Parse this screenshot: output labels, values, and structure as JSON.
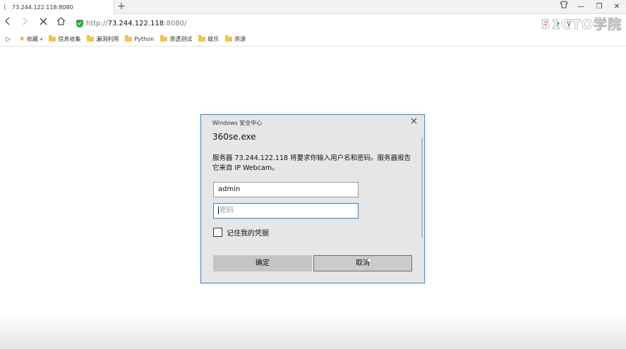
{
  "tab": {
    "title": "73.244.122.118:8080"
  },
  "window_controls": {
    "shirt": "shirt-icon",
    "minimize": "—",
    "restore": "❐",
    "close": "✕"
  },
  "address": {
    "protocol": "http://",
    "host": "73.244.122.118",
    "port": ":8080/"
  },
  "watermark": "51CTO学院",
  "bookmarks": {
    "toggle": "▷",
    "items": [
      {
        "label": "收藏",
        "icon": "star-icon"
      },
      {
        "label": "信息收集",
        "icon": "folder-icon"
      },
      {
        "label": "漏洞利用",
        "icon": "folder-icon"
      },
      {
        "label": "Python",
        "icon": "folder-icon"
      },
      {
        "label": "渗透测试",
        "icon": "folder-icon"
      },
      {
        "label": "娱乐",
        "icon": "folder-icon"
      },
      {
        "label": "资源",
        "icon": "folder-icon"
      }
    ]
  },
  "dialog": {
    "title": "Windows 安全中心",
    "app": "360se.exe",
    "message": "服务器 73.244.122.118 将要求你输入用户名和密码。服务器报告它来自 IP Webcam。",
    "username_value": "admin",
    "password_placeholder": "密码",
    "remember_label": "记住我的凭据",
    "ok_label": "确定",
    "cancel_label": "取消",
    "accent": "#3c8ad8"
  }
}
